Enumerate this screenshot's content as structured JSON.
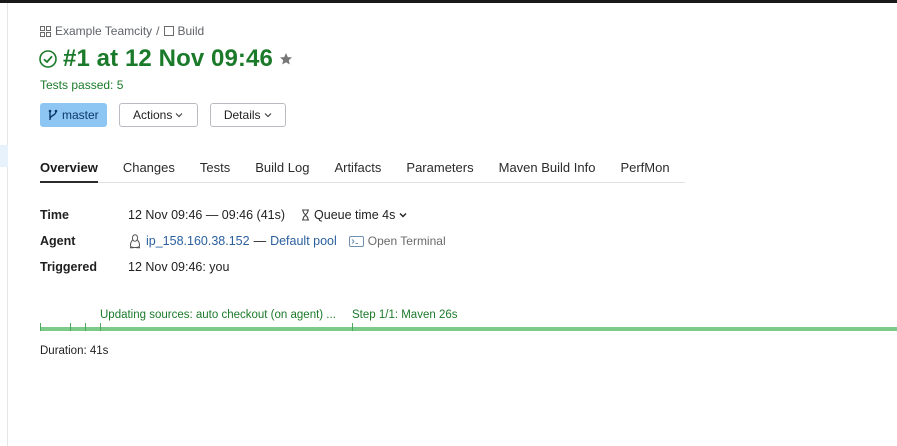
{
  "breadcrumb": {
    "project": "Example Teamcity",
    "separator": "/",
    "build_config": "Build"
  },
  "header": {
    "title": "#1 at 12 Nov 09:46",
    "status_text": "Tests passed: 5",
    "status_color": "#1b7a2a"
  },
  "buttons": {
    "branch": "master",
    "actions": "Actions",
    "details": "Details"
  },
  "tabs": [
    {
      "label": "Overview",
      "active": true
    },
    {
      "label": "Changes"
    },
    {
      "label": "Tests"
    },
    {
      "label": "Build Log"
    },
    {
      "label": "Artifacts"
    },
    {
      "label": "Parameters"
    },
    {
      "label": "Maven Build Info"
    },
    {
      "label": "PerfMon"
    }
  ],
  "info": {
    "time_label": "Time",
    "time_value": "12 Nov 09:46 — 09:46 (41s)",
    "queue_time": "Queue time 4s",
    "agent_label": "Agent",
    "agent_name": "ip_158.160.38.152",
    "agent_sep": "—",
    "agent_pool": "Default pool",
    "open_terminal": "Open Terminal",
    "triggered_label": "Triggered",
    "triggered_value": "12 Nov 09:46: you"
  },
  "timeline": {
    "stage1": "Updating sources: auto checkout (on agent) ...",
    "stage2": "Step 1/1: Maven 26s"
  },
  "duration": "Duration: 41s",
  "colors": {
    "success_green": "#1b7a2a",
    "branch_blue": "#8ec6f3",
    "timeline_green": "#7ccb8a"
  }
}
